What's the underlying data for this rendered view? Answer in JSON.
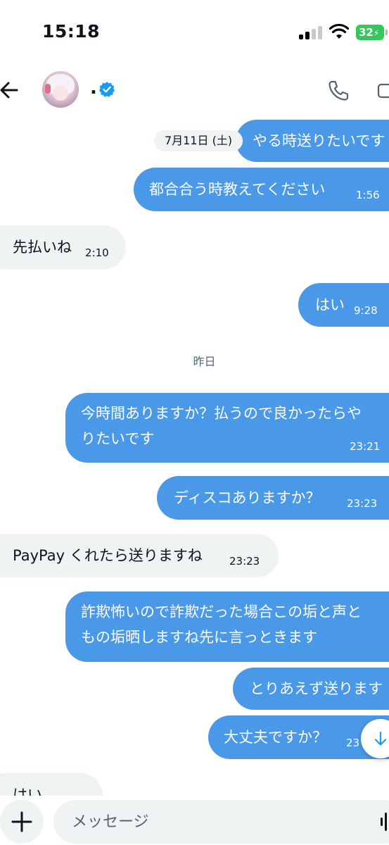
{
  "status_bar": {
    "time": "15:18",
    "battery": "32"
  },
  "header": {
    "name": "."
  },
  "chat": {
    "date_pill": "7月11日 (土)",
    "day_separator": "昨日",
    "messages": [
      {
        "side": "sent",
        "text": "やる時送りたいです"
      },
      {
        "side": "sent",
        "text": "都合合う時教えてください",
        "time": "1:56"
      },
      {
        "side": "recv",
        "text": "先払いね",
        "time": "2:10"
      },
      {
        "side": "sent",
        "text": "はい",
        "time": "9:28"
      },
      {
        "side": "sent",
        "line1": "今時間ありますか？払うので良かったらや",
        "line2": "りたいです",
        "time": "23:21"
      },
      {
        "side": "sent",
        "text": "ディスコありますか？",
        "time": "23:23"
      },
      {
        "side": "recv",
        "text": "PayPay くれたら送りますね",
        "time": "23:23"
      },
      {
        "side": "sent",
        "line1": "詐欺怖いので詐欺だった場合この垢と声と",
        "line2": "もの垢晒しますね先に言っときます"
      },
      {
        "side": "sent",
        "text": "とりあえず送ります"
      },
      {
        "side": "sent",
        "text": "大丈夫ですか？",
        "time": "23"
      },
      {
        "side": "recv",
        "text": "はい"
      }
    ]
  },
  "composer": {
    "placeholder": "メッセージ"
  }
}
